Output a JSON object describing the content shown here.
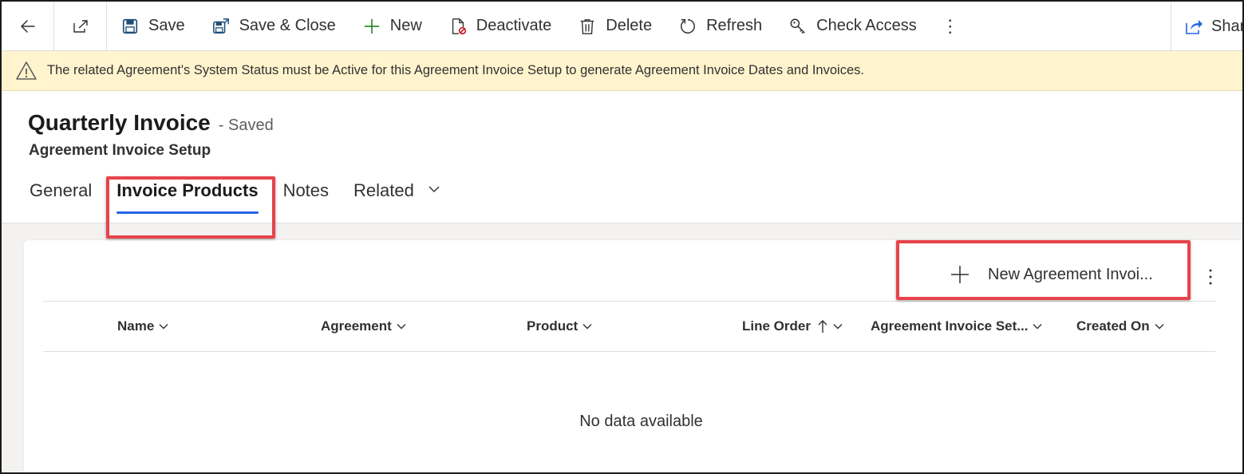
{
  "command_bar": {
    "back_icon": "back-arrow-icon",
    "popout_icon": "open-in-new-window-icon",
    "save": "Save",
    "save_close": "Save & Close",
    "new": "New",
    "deactivate": "Deactivate",
    "delete": "Delete",
    "refresh": "Refresh",
    "check_access": "Check Access",
    "more": "⋮",
    "share": "Share"
  },
  "warning": {
    "icon": "warning-icon",
    "text": "The related Agreement's System Status must be Active for this Agreement Invoice Setup to generate Agreement Invoice Dates and Invoices."
  },
  "header": {
    "title": "Quarterly Invoice",
    "status": "- Saved",
    "entity": "Agreement Invoice Setup"
  },
  "tabs": [
    {
      "label": "General",
      "active": false
    },
    {
      "label": "Invoice Products",
      "active": true
    },
    {
      "label": "Notes",
      "active": false
    },
    {
      "label": "Related",
      "active": false
    }
  ],
  "grid": {
    "new_button": "New Agreement Invoi...",
    "more": "⋮",
    "columns": [
      {
        "label": "Name",
        "sorted": false
      },
      {
        "label": "Agreement",
        "sorted": false
      },
      {
        "label": "Product",
        "sorted": false
      },
      {
        "label": "Line Order",
        "sorted": true
      },
      {
        "label": "Agreement Invoice Set...",
        "sorted": false
      },
      {
        "label": "Created On",
        "sorted": false
      }
    ],
    "empty_message": "No data available"
  },
  "colors": {
    "accent": "#2266e3",
    "highlight": "#e8434b",
    "warning_bg": "#fff4ce",
    "add_green": "#107c10"
  }
}
